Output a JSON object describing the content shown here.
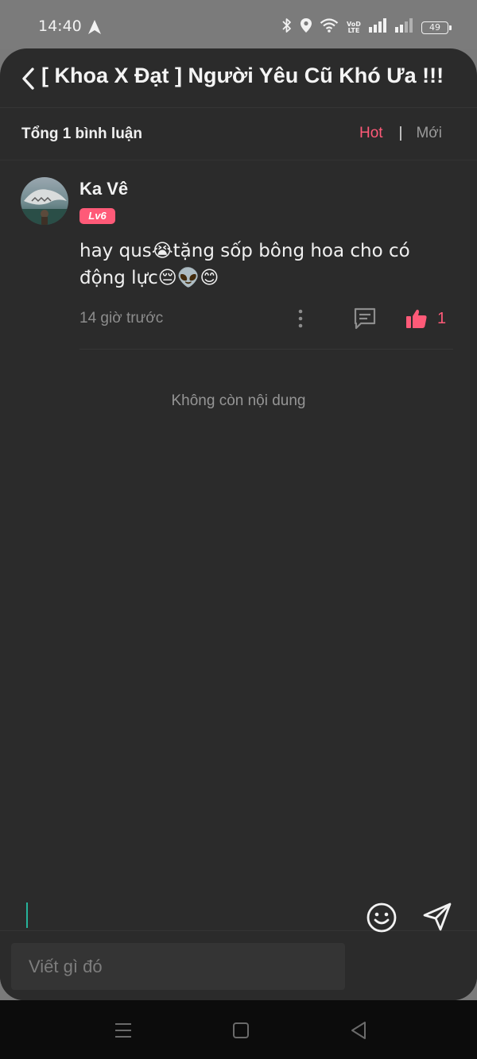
{
  "status_bar": {
    "time": "14:40",
    "volte_line1": "VoD",
    "volte_line2": "LTE",
    "battery": "49",
    "icons": [
      "navigation-arrow-icon",
      "bluetooth-icon",
      "location-icon",
      "wifi-icon",
      "volte-icon",
      "signal-icon",
      "signal-icon",
      "battery-icon"
    ]
  },
  "header": {
    "title": "[ Khoa X Đạt ] Người Yêu Cũ Khó Ưa !!!",
    "back_icon": "chevron-left-icon"
  },
  "subheader": {
    "total": "Tổng 1 bình luận",
    "sort_hot": "Hot",
    "sort_separator": "|",
    "sort_new": "Mới"
  },
  "comment": {
    "user": "Ka Vê",
    "level": "Lv6",
    "text": "hay qus😭tặng sốp bông hoa cho có động lực😔👽😊",
    "time": "14 giờ trước",
    "likes": "1"
  },
  "empty_state": "Không còn nội dung",
  "input": {
    "placeholder": "Viết gì đó"
  },
  "colors": {
    "accent": "#ff5a78",
    "background": "#2b2b2b",
    "status_bar": "#7b7b7b",
    "caret": "#26b39a"
  }
}
